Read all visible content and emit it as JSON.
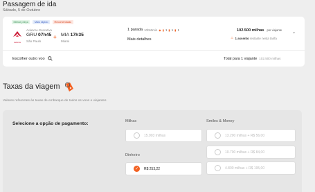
{
  "header": {
    "title": "Passagem de ida",
    "date": "Sábado, 5 de Outubro"
  },
  "flight": {
    "tags": [
      "Menor preço",
      "Mais rápido",
      "Recomendado"
    ],
    "tag_colors": [
      "#2e8b4f",
      "#3a5fc2",
      "#d8451f"
    ],
    "airline_logo_text": "avianca",
    "airline": "Avianca • Executiva",
    "origin_code": "GRU",
    "origin_time": "07h45",
    "origin_city": "São Paulo",
    "dest_code": "MIA",
    "dest_time": "17h35",
    "dest_city": "Miami",
    "stops": "1 parada",
    "duration": "10h50min",
    "bags": [
      "1",
      "1",
      "1"
    ],
    "details_label": "Mais detalhes",
    "price": "102.500 milhas",
    "per_traveler": "por viajante",
    "seats_bold": "1 assento",
    "seats_rest": "restante nesta tarifa",
    "other_flight_label": "Escolher outro voo",
    "total_label": "Total para 1 viajante",
    "total_miles": "102.500 milhas"
  },
  "taxes": {
    "title": "Taxas da viagem",
    "description": "Valores referentes às taxas de embarque de todos os voos e viajantes",
    "payment_label": "Selecione a opção de pagamento:",
    "miles_title": "Milhas",
    "miles_option": "15.903 milhas",
    "money_title": "Dinheiro",
    "money_option": "R$ 253,22",
    "smiles_title": "Smiles & Money",
    "smiles_options": [
      "13.200 milhas + R$ 56,00",
      "10.700 milhas + R$ 84,00",
      "4.800 milhas + R$ 195,00"
    ],
    "selected": "Dinheiro"
  },
  "colors": {
    "accent": "#f26122",
    "background": "#eeeeee",
    "card": "#ffffff"
  }
}
